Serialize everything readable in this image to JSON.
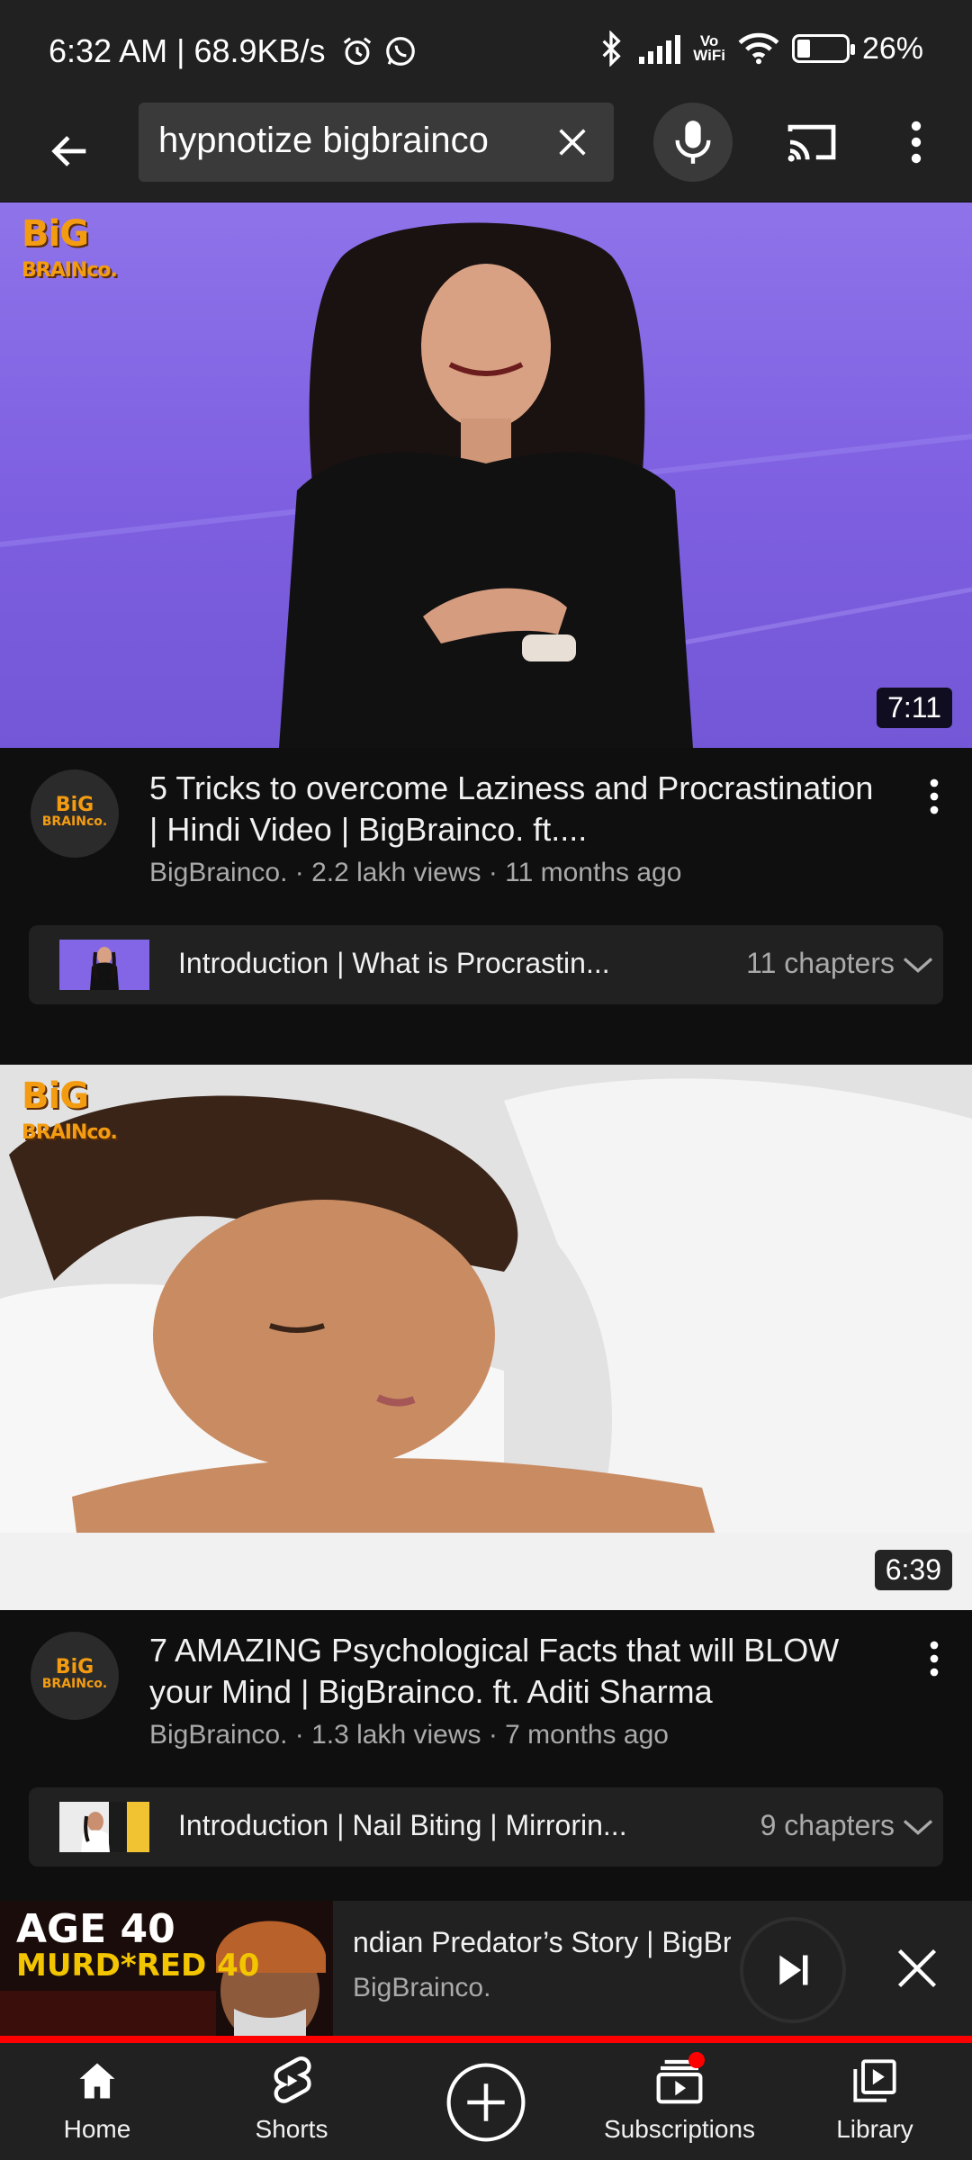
{
  "status_bar": {
    "time_speed": "6:32 AM | 68.9KB/s",
    "icons": [
      "alarm-icon",
      "whatsapp-icon",
      "bluetooth-icon",
      "signal-icon",
      "vowifi-icon",
      "wifi-icon",
      "battery-icon"
    ],
    "vowifi_line1": "Vo",
    "vowifi_line2": "WiFi",
    "battery_percent": "26%",
    "battery_level": 0.26
  },
  "search": {
    "query": "hypnotize bigbrainco"
  },
  "videos": [
    {
      "logo_line1": "BiG",
      "logo_line2": "BRAINco.",
      "duration": "7:11",
      "title": "5 Tricks to overcome Laziness and Procrastination | Hindi Video | BigBrainco. ft....",
      "subtitle": "BigBrainco. · 2.2 lakh views · 11 months ago",
      "chapter_title": "Introduction | What is Procrastin...",
      "chapter_count": "11 chapters"
    },
    {
      "logo_line1": "BiG",
      "logo_line2": "BRAINco.",
      "duration": "6:39",
      "title": "7 AMAZING Psychological Facts that will BLOW your Mind | BigBrainco. ft. Aditi Sharma",
      "subtitle": "BigBrainco. · 1.3 lakh views · 7 months ago",
      "chapter_title": "Introduction | Nail Biting | Mirrorin...",
      "chapter_count": "9 chapters"
    }
  ],
  "mini_player": {
    "thumb_line1": "AGE 40",
    "thumb_line2": "MURD*RED 40",
    "title": "ndian Predator’s Story | BigBr",
    "channel": "BigBrainco.",
    "progress": 1.0
  },
  "bottom_nav": {
    "items": [
      {
        "label": "Home",
        "icon": "home-icon"
      },
      {
        "label": "Shorts",
        "icon": "shorts-icon"
      },
      {
        "label": "",
        "icon": "create-icon"
      },
      {
        "label": "Subscriptions",
        "icon": "subscriptions-icon"
      },
      {
        "label": "Library",
        "icon": "library-icon"
      }
    ]
  },
  "colors": {
    "background": "#0f0f0f",
    "surface": "#212121",
    "accent_red": "#ff0000",
    "secondary_text": "#aaaaaa",
    "thumb1_purple": "#7d5fe0",
    "brand_orange": "#f39c12"
  }
}
